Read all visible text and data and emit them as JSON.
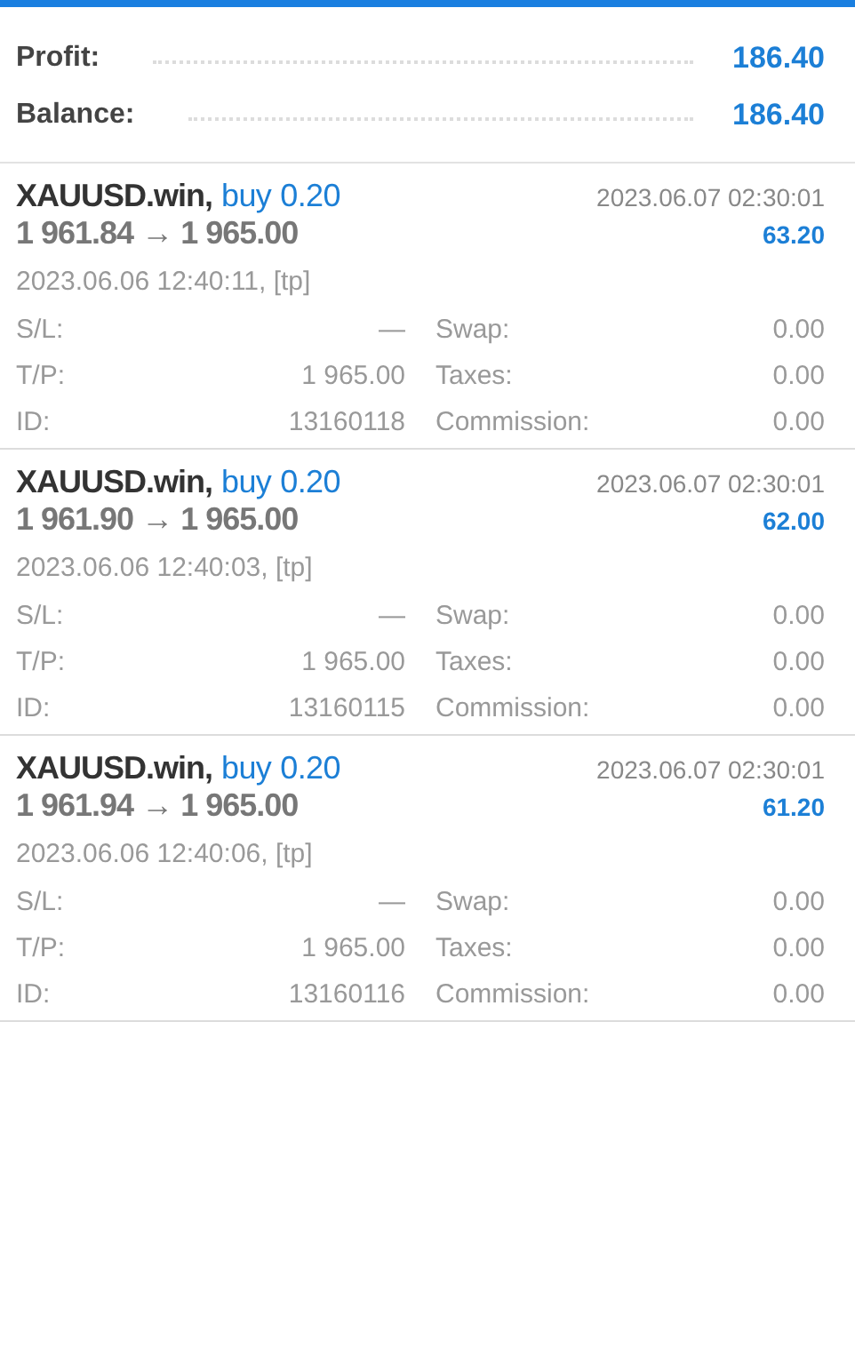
{
  "summary": [
    {
      "label": "Profit:",
      "value": "186.40"
    },
    {
      "label": "Balance:",
      "value": "186.40"
    }
  ],
  "deals": [
    {
      "symbol": "XAUUSD.win,",
      "side": "buy",
      "volume": "0.20",
      "close_time": "2023.06.07 02:30:01",
      "prices": "1 961.84 → 1 965.00",
      "profit": "63.20",
      "open_time": "2023.06.06 12:40:11, [tp]",
      "fields": [
        {
          "label": "S/L:",
          "value": "—"
        },
        {
          "label": "Swap:",
          "value": "0.00"
        },
        {
          "label": "T/P:",
          "value": "1 965.00"
        },
        {
          "label": "Taxes:",
          "value": "0.00"
        },
        {
          "label": "ID:",
          "value": "13160118"
        },
        {
          "label": "Commission:",
          "value": "0.00"
        }
      ]
    },
    {
      "symbol": "XAUUSD.win,",
      "side": "buy",
      "volume": "0.20",
      "close_time": "2023.06.07 02:30:01",
      "prices": "1 961.90 → 1 965.00",
      "profit": "62.00",
      "open_time": "2023.06.06 12:40:03, [tp]",
      "fields": [
        {
          "label": "S/L:",
          "value": "—"
        },
        {
          "label": "Swap:",
          "value": "0.00"
        },
        {
          "label": "T/P:",
          "value": "1 965.00"
        },
        {
          "label": "Taxes:",
          "value": "0.00"
        },
        {
          "label": "ID:",
          "value": "13160115"
        },
        {
          "label": "Commission:",
          "value": "0.00"
        }
      ]
    },
    {
      "symbol": "XAUUSD.win,",
      "side": "buy",
      "volume": "0.20",
      "close_time": "2023.06.07 02:30:01",
      "prices": "1 961.94 → 1 965.00",
      "profit": "61.20",
      "open_time": "2023.06.06 12:40:06, [tp]",
      "fields": [
        {
          "label": "S/L:",
          "value": "—"
        },
        {
          "label": "Swap:",
          "value": "0.00"
        },
        {
          "label": "T/P:",
          "value": "1 965.00"
        },
        {
          "label": "Taxes:",
          "value": "0.00"
        },
        {
          "label": "ID:",
          "value": "13160116"
        },
        {
          "label": "Commission:",
          "value": "0.00"
        }
      ]
    }
  ]
}
